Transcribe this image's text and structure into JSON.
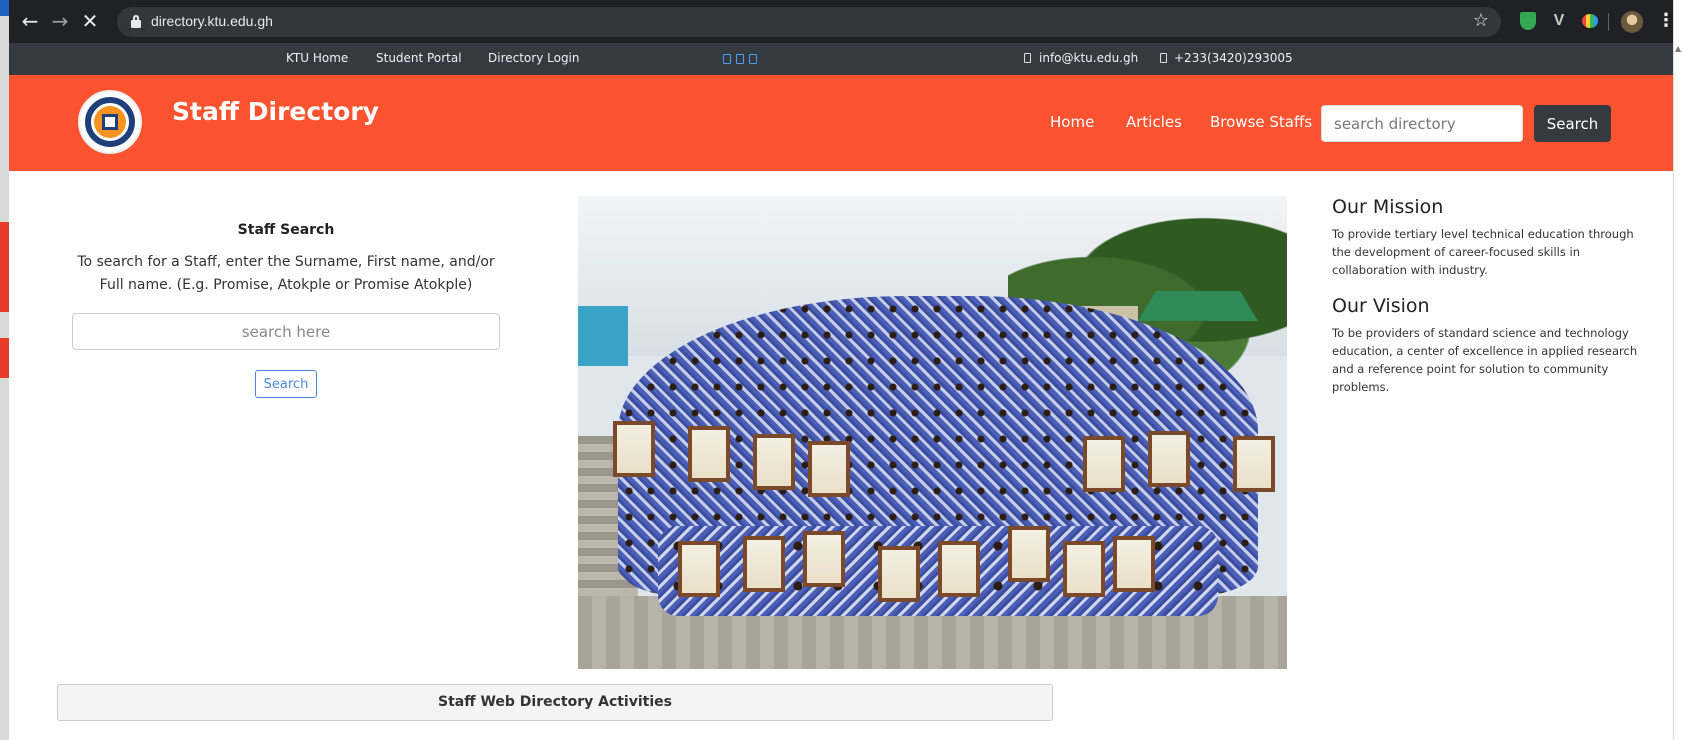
{
  "browser": {
    "url": "directory.ktu.edu.gh",
    "back_icon": "arrow-left-icon",
    "forward_icon": "arrow-right-icon",
    "stop_icon": "close-icon",
    "lock_icon": "lock-icon",
    "bookmark_icon": "star-icon"
  },
  "topbar": {
    "links": [
      "KTU Home",
      "Student Portal",
      "Directory Login"
    ],
    "social_icons": [
      "facebook-icon",
      "twitter-icon",
      "linkedin-icon"
    ],
    "email": "info@ktu.edu.gh",
    "phone": "+233(3420)293005",
    "accent": "#4a9ff5"
  },
  "header": {
    "title": "Staff Directory",
    "nav": [
      "Home",
      "Articles",
      "Browse Staffs"
    ],
    "search_placeholder": "search directory",
    "search_button": "Search",
    "bg_color": "#fb532f"
  },
  "staff_search": {
    "title": "Staff Search",
    "description": "To search for a Staff, enter the Surname, First name, and/or Full name. (E.g. Promise, Atokple or Promise Atokple)",
    "input_placeholder": "search here",
    "button": "Search"
  },
  "mission": {
    "heading": "Our Mission",
    "text": "To provide tertiary level technical education through the development of career-focused skills in collaboration with industry."
  },
  "vision": {
    "heading": "Our Vision",
    "text": "To be providers of standard science and technology education, a center of excellence in applied research and a reference point for solution to community problems."
  },
  "activities": {
    "title": "Staff Web Directory Activities"
  }
}
